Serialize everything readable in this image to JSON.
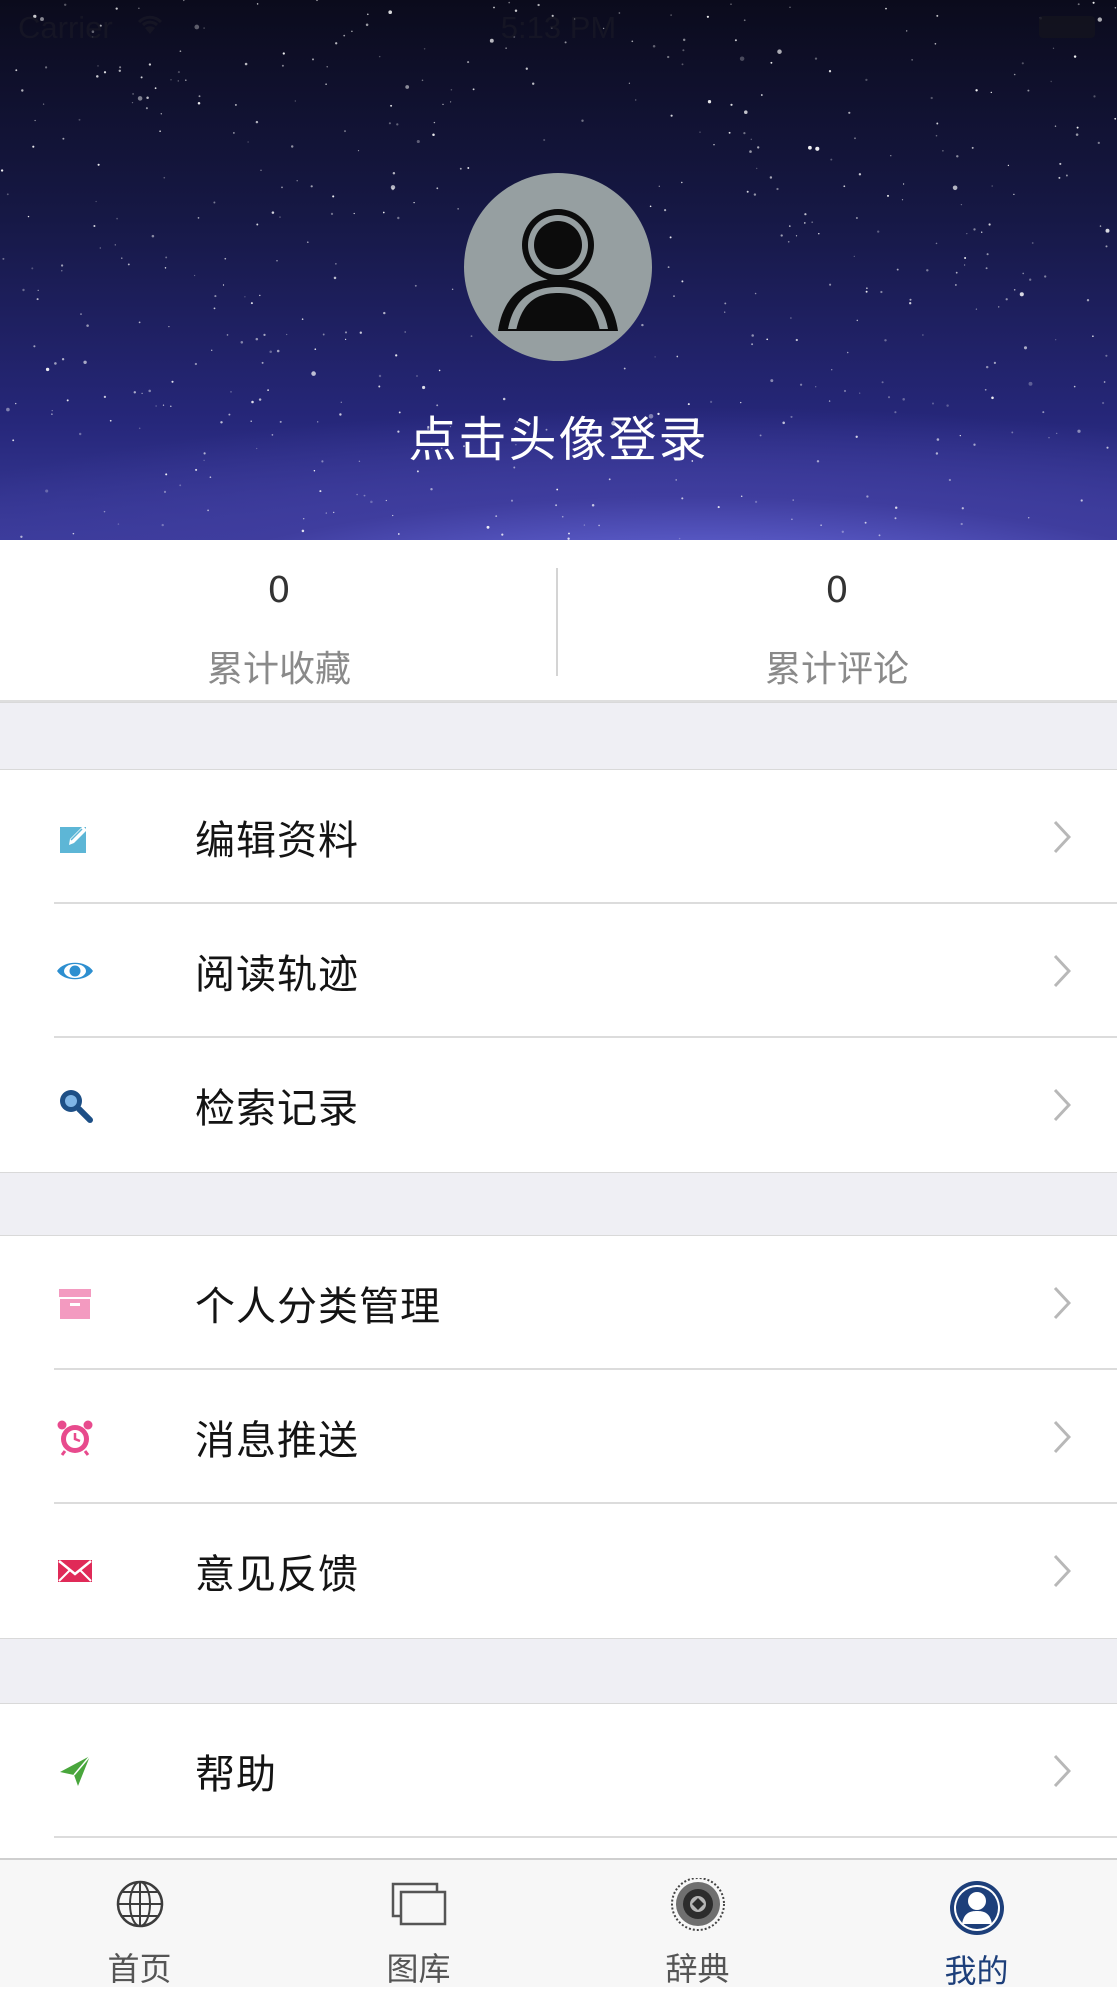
{
  "status_bar": {
    "carrier": "Carrier",
    "time": "5:13 PM"
  },
  "profile": {
    "login_prompt": "点击头像登录"
  },
  "stats": [
    {
      "value": "0",
      "label": "累计收藏"
    },
    {
      "value": "0",
      "label": "累计评论"
    }
  ],
  "menu": {
    "group1": [
      {
        "label": "编辑资料",
        "icon": "edit-icon",
        "color": "#5db6d6"
      },
      {
        "label": "阅读轨迹",
        "icon": "eye-icon",
        "color": "#2d8fd0"
      },
      {
        "label": "检索记录",
        "icon": "search-icon",
        "color": "#1d4f86"
      }
    ],
    "group2": [
      {
        "label": "个人分类管理",
        "icon": "archive-box-icon",
        "color": "#f39ac0"
      },
      {
        "label": "消息推送",
        "icon": "alarm-clock-icon",
        "color": "#e84a8d"
      },
      {
        "label": "意见反馈",
        "icon": "mail-icon",
        "color": "#e02a58"
      }
    ],
    "group3": [
      {
        "label": "帮助",
        "icon": "paper-plane-icon",
        "color": "#49a63c"
      }
    ]
  },
  "tabbar": {
    "items": [
      {
        "label": "首页",
        "icon": "globe-icon"
      },
      {
        "label": "图库",
        "icon": "gallery-icon"
      },
      {
        "label": "辞典",
        "icon": "dictionary-badge-icon"
      },
      {
        "label": "我的",
        "icon": "profile-icon",
        "active": true
      }
    ],
    "active_color": "#1d3f7a"
  },
  "colors": {
    "background_gray": "#efeff4",
    "chevron": "#b8b8b8"
  }
}
